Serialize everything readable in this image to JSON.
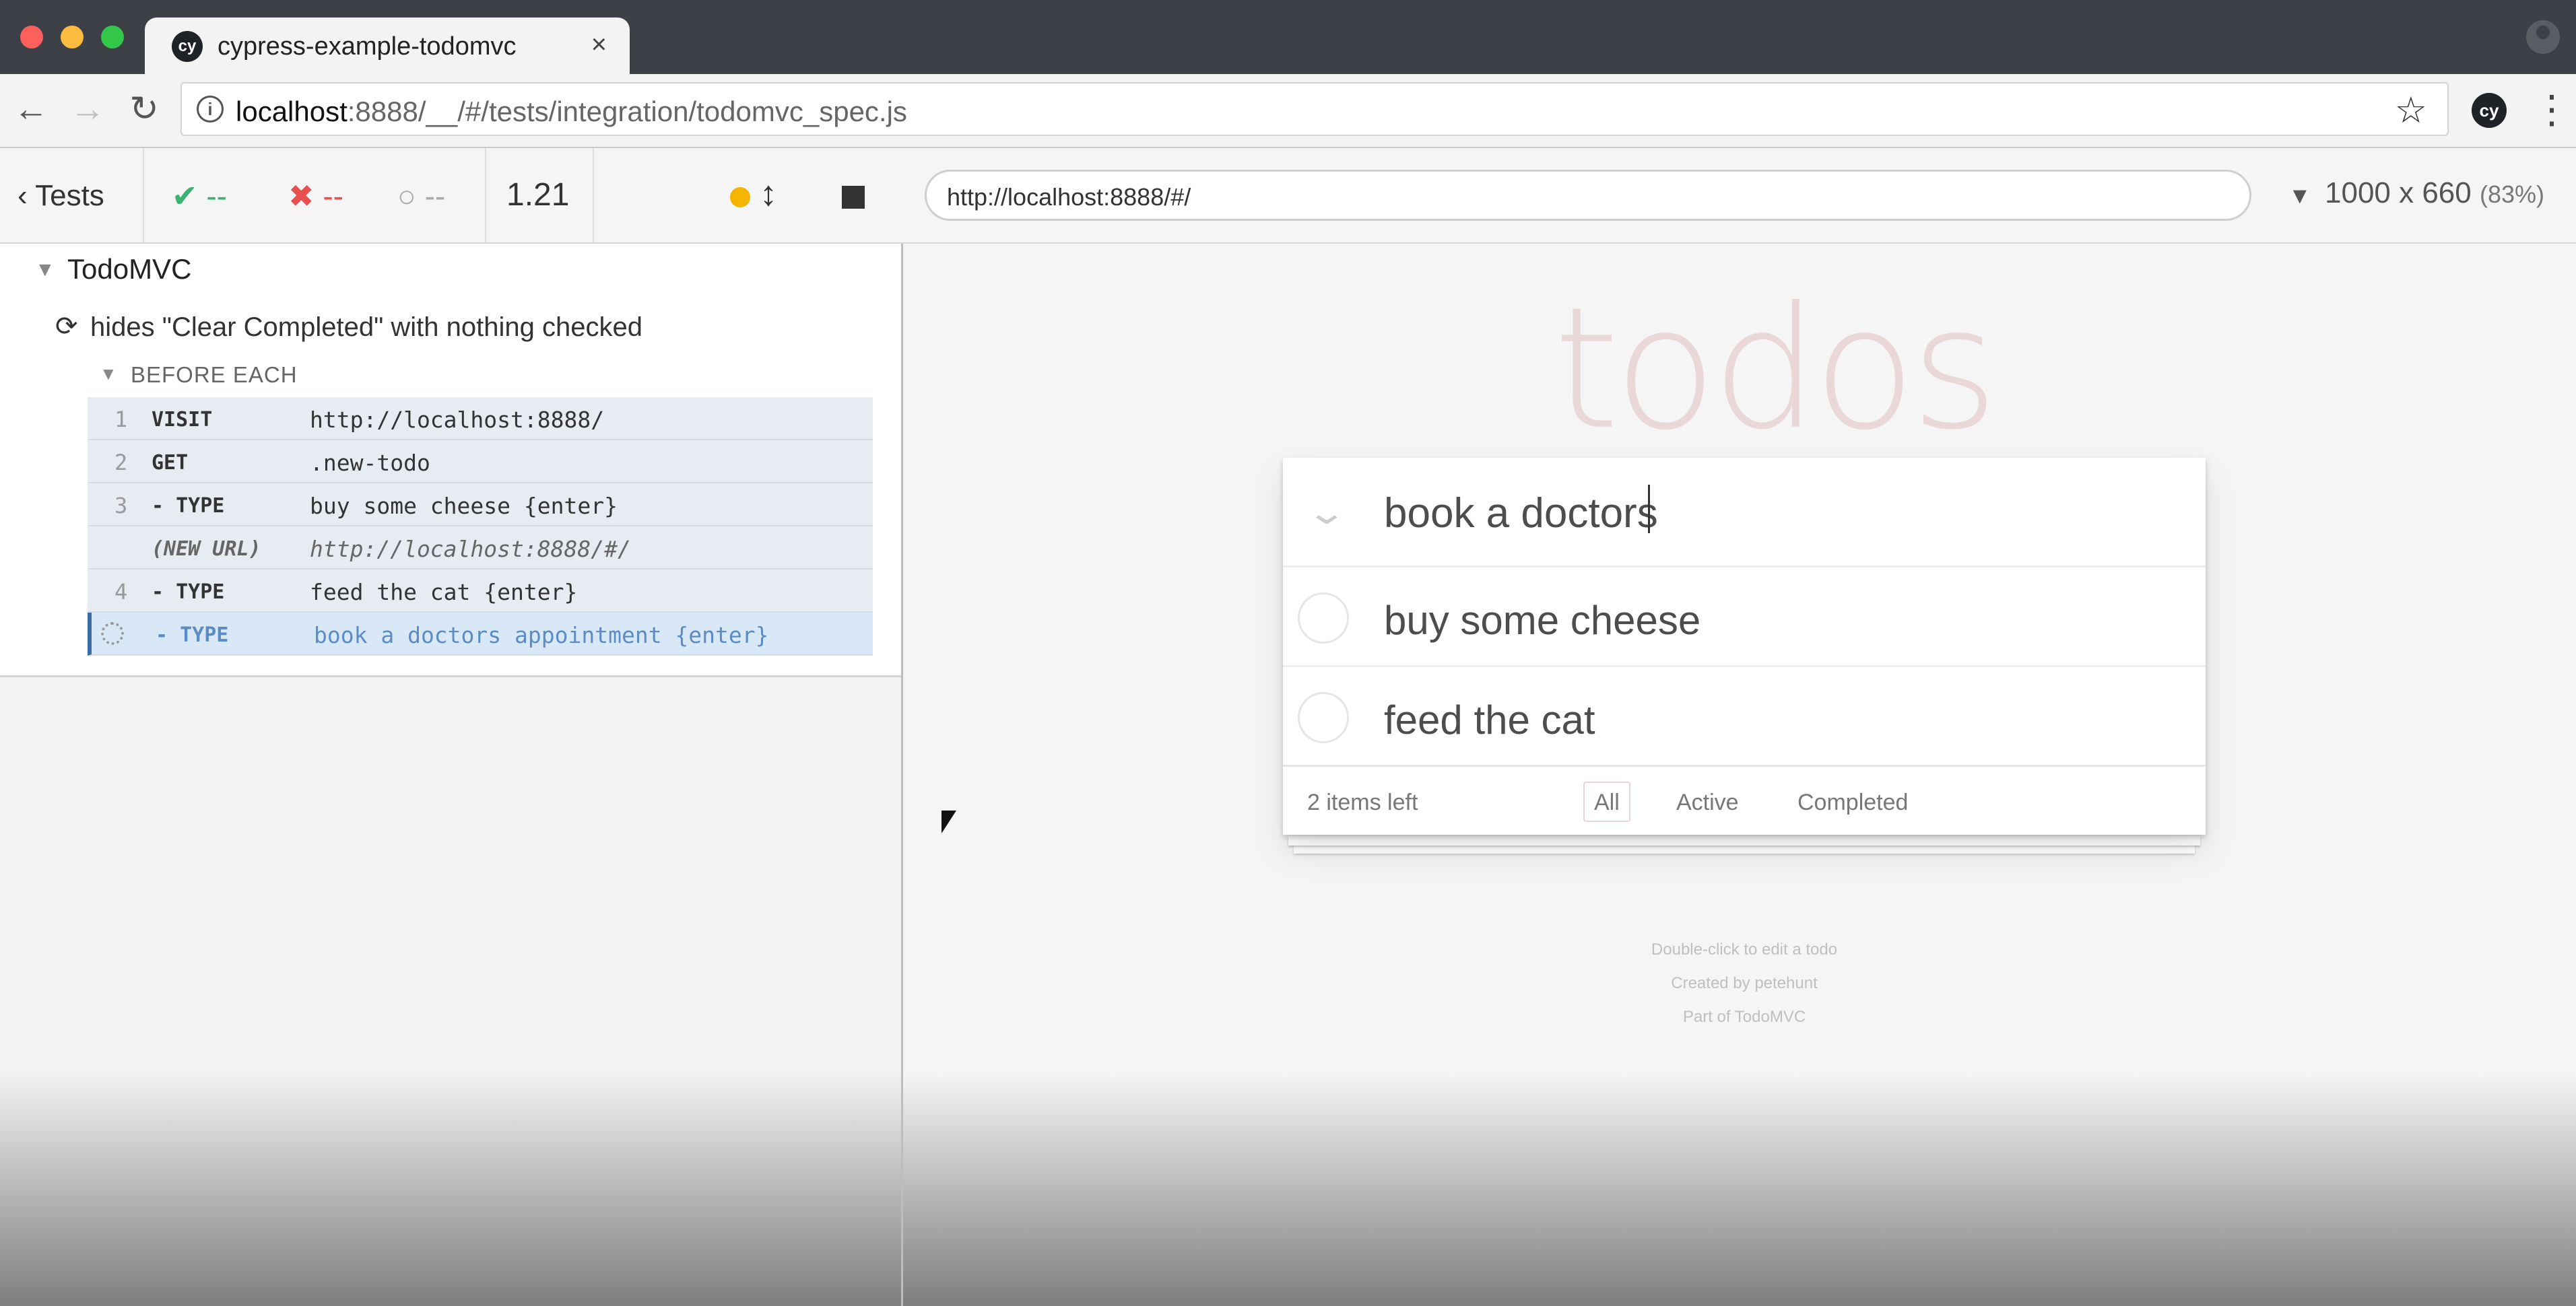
{
  "browser": {
    "tab_title": "cypress-example-todomvc",
    "tab_favicon": "cy",
    "tab_close": "×",
    "url_host": "localhost",
    "url_rest": ":8888/__/#/tests/integration/todomvc_spec.js",
    "extension_label": "cy"
  },
  "reporter_header": {
    "tests_label": "Tests",
    "passed": "--",
    "failed": "--",
    "pending": "--",
    "duration": "1.21",
    "aut_url": "http://localhost:8888/#/",
    "viewport": "1000 x 660",
    "scale": "(83%)"
  },
  "reporter": {
    "suite_title": "TodoMVC",
    "test_title": "hides \"Clear Completed\" with nothing checked",
    "hook_title": "BEFORE EACH",
    "commands": [
      {
        "num": "1",
        "name": "VISIT",
        "message": "http://localhost:8888/"
      },
      {
        "num": "2",
        "name": "GET",
        "message": ".new-todo"
      },
      {
        "num": "3",
        "name": "- TYPE",
        "message": "buy some cheese {enter}"
      },
      {
        "num": "",
        "name": "(NEW URL)",
        "message": "http://localhost:8888/#/"
      },
      {
        "num": "4",
        "name": "- TYPE",
        "message": "feed the cat {enter}"
      },
      {
        "num": "",
        "name": "- TYPE",
        "message": "book a doctors appointment {enter}"
      }
    ]
  },
  "aut": {
    "heading": "todos",
    "new_todo_value": "book a doctors",
    "todos": [
      {
        "label": "buy some cheese"
      },
      {
        "label": "feed the cat"
      }
    ],
    "footer": {
      "count": "2 items left",
      "filters": [
        "All",
        "Active",
        "Completed"
      ]
    },
    "info": [
      "Double-click to edit a todo",
      "Created by petehunt",
      "Part of TodoMVC"
    ]
  },
  "colors": {
    "pass": "#3cb371",
    "fail": "#e94f4f",
    "running": "#f4b400",
    "active_command": "#5b8cc4"
  },
  "icons": {
    "back": "arrow-left-icon",
    "forward": "arrow-right-icon",
    "reload": "reload-icon",
    "info": "info-icon",
    "star": "star-icon",
    "menu": "kebab-menu-icon",
    "pass": "checkmark-icon",
    "fail": "cross-icon",
    "pending": "circle-icon",
    "scroll": "vertical-arrows-icon",
    "stop": "stop-icon"
  }
}
